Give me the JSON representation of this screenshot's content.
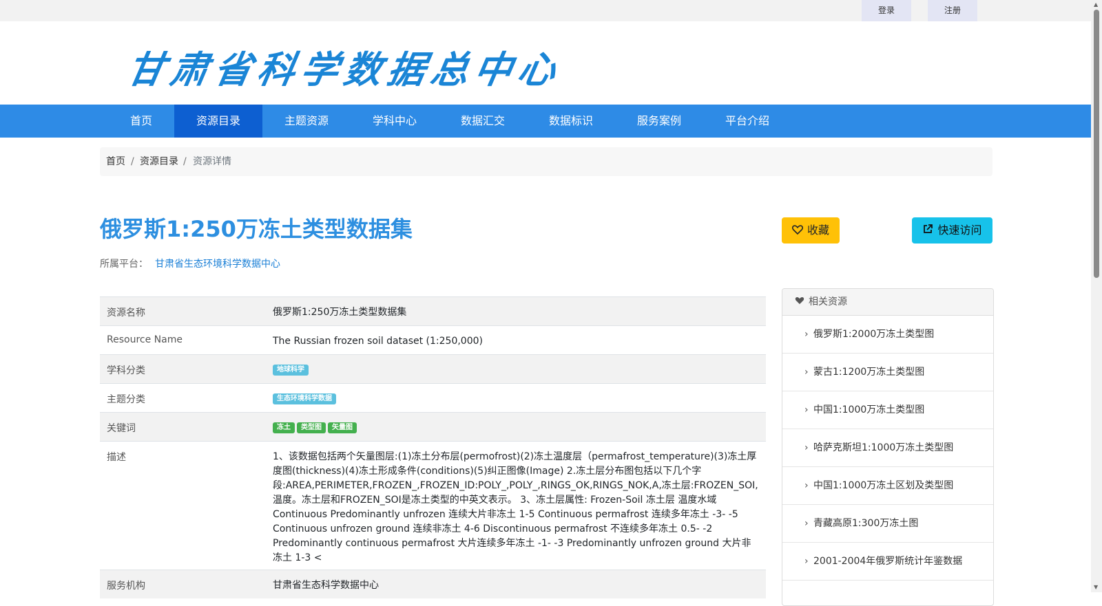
{
  "topbar": {
    "login": "登录",
    "register": "注册"
  },
  "logo": {
    "text": "甘肃省科学数据总中心",
    "color": "#1a85d6"
  },
  "nav": {
    "items": [
      {
        "label": "首页"
      },
      {
        "label": "资源目录",
        "active": true
      },
      {
        "label": "主题资源"
      },
      {
        "label": "学科中心"
      },
      {
        "label": "数据汇交"
      },
      {
        "label": "数据标识"
      },
      {
        "label": "服务案例"
      },
      {
        "label": "平台介绍"
      }
    ]
  },
  "breadcrumb": {
    "home": "首页",
    "catalog": "资源目录",
    "current": "资源详情",
    "sep": "/"
  },
  "title": "俄罗斯1:250万冻土类型数据集",
  "platform": {
    "label": "所属平台：",
    "name": "甘肃省生态环境科学数据中心"
  },
  "buttons": {
    "favorite": "收藏",
    "quick_visit": "快速访问"
  },
  "detail": {
    "resource_name": {
      "key": "资源名称",
      "value": "俄罗斯1:250万冻土类型数据集"
    },
    "resource_name_en": {
      "key": "Resource Name",
      "value": "The Russian frozen soil dataset (1:250,000)"
    },
    "discipline": {
      "key": "学科分类",
      "tags": [
        "地球科学"
      ]
    },
    "theme": {
      "key": "主题分类",
      "tags": [
        "生态环境科学数据"
      ]
    },
    "keywords": {
      "key": "关键词",
      "tags": [
        "冻土",
        "类型图",
        "矢量图"
      ]
    },
    "description": {
      "key": "描述",
      "value": "1、该数据包括两个矢量图层:(1)冻土分布层(permofrost)(2)冻土温度层（permafrost_temperature)(3)冻土厚度图(thickness)(4)冻土形成条件(conditions)(5)纠正图像(Image) 2.冻土层分布图包括以下几个字段:AREA,PERIMETER,FROZEN_,FROZEN_ID:POLY_,POLY_,RINGS_OK,RINGS_NOK,A,冻土层:FROZEN_SOI,温度。冻土层和FROZEN_SOI是冻土类型的中英文表示。 3、冻土层属性: Frozen-Soil 冻土层 温度水域 Continuous Predominantly unfrozen 连续大片非冻土 1-5 Continuous permafrost 连续多年冻土 -3- -5 Continuous unfrozen ground 连续非冻土 4-6 Discontinuous permafrost 不连续多年冻土 0.5- -2 Predominantly continuous permafrost 大片连续多年冻土 -1- -3 Predominantly unfrozen ground 大片非冻土 1-3 <"
    },
    "org": {
      "key": "服务机构",
      "value": "甘肃省生态科学数据中心"
    }
  },
  "related": {
    "title": "相关资源",
    "items": [
      "俄罗斯1:2000万冻土类型图",
      "蒙古1:1200万冻土类型图",
      "中国1:1000万冻土类型图",
      "哈萨克斯坦1:1000万冻土类型图",
      "中国1:1000万冻土区划及类型图",
      "青藏高原1:300万冻土图",
      "2001-2004年俄罗斯统计年鉴数据"
    ]
  }
}
